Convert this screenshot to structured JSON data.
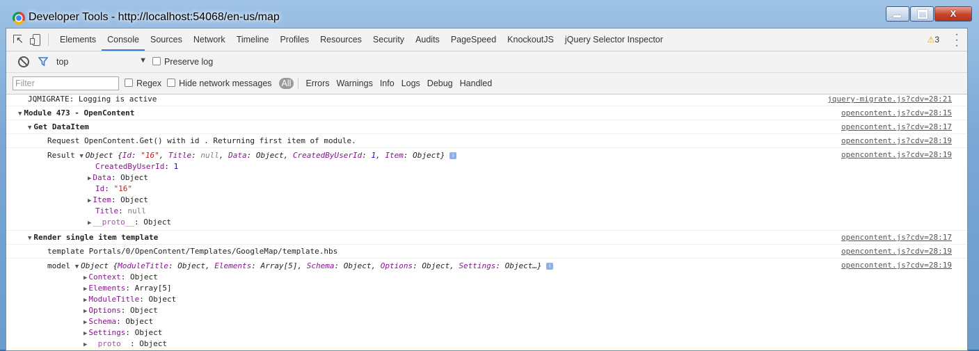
{
  "window": {
    "title": "Developer Tools - http://localhost:54068/en-us/map",
    "close_glyph": "X"
  },
  "tabs": [
    "Elements",
    "Console",
    "Sources",
    "Network",
    "Timeline",
    "Profiles",
    "Resources",
    "Security",
    "Audits",
    "PageSpeed",
    "KnockoutJS",
    "jQuery Selector Inspector"
  ],
  "active_tab": "Console",
  "warnings_count": "3",
  "context": {
    "value": "top",
    "preserve_log_label": "Preserve log"
  },
  "filter": {
    "placeholder": "Filter",
    "regex_label": "Regex",
    "hide_network_label": "Hide network messages",
    "levels": [
      "All",
      "Errors",
      "Warnings",
      "Info",
      "Logs",
      "Debug",
      "Handled"
    ]
  },
  "console": {
    "msg1": {
      "text": "JQMIGRATE: Logging is active",
      "src": "jquery-migrate.js?cdv=28:21"
    },
    "group1": {
      "text": "Module 473 - OpenContent",
      "src": "opencontent.js?cdv=28:15"
    },
    "group2": {
      "text": "Get DataItem",
      "src": "opencontent.js?cdv=28:17"
    },
    "msg2": {
      "text": "Request OpenContent.Get() with id . Returning first item of module.",
      "src": "opencontent.js?cdv=28:19"
    },
    "result": {
      "label": "Result",
      "src": "opencontent.js?cdv=28:19",
      "summary_prefix": "Object {",
      "s_id_key": "Id",
      "s_id_val": "\"16\"",
      "s_title_key": "Title",
      "s_title_val": "null",
      "s_data_key": "Data",
      "s_data_val": "Object",
      "s_cby_key": "CreatedByUserId",
      "s_cby_val": "1",
      "s_item_key": "Item",
      "s_item_val": "Object",
      "summary_suffix": "}",
      "props": [
        {
          "key": "CreatedByUserId",
          "val": "1"
        },
        {
          "key": "Data",
          "val": "Object"
        },
        {
          "key": "Id",
          "val": "\"16\""
        },
        {
          "key": "Item",
          "val": "Object"
        },
        {
          "key": "Title",
          "val": "null"
        },
        {
          "key": "__proto__",
          "val": "Object"
        }
      ]
    },
    "group3": {
      "text": "Render single item template",
      "src": "opencontent.js?cdv=28:17"
    },
    "msg3": {
      "text": "template Portals/0/OpenContent/Templates/GoogleMap/template.hbs",
      "src": "opencontent.js?cdv=28:19"
    },
    "model": {
      "label": "model",
      "src": "opencontent.js?cdv=28:19",
      "summary_prefix": "Object {",
      "s_mt_key": "ModuleTitle",
      "s_mt_val": "Object",
      "s_el_key": "Elements",
      "s_el_val": "Array[5]",
      "s_sc_key": "Schema",
      "s_sc_val": "Object",
      "s_op_key": "Options",
      "s_op_val": "Object",
      "s_se_key": "Settings",
      "s_se_val": "Object…}",
      "props": [
        {
          "key": "Context",
          "val": "Object"
        },
        {
          "key": "Elements",
          "val": "Array[5]"
        },
        {
          "key": "ModuleTitle",
          "val": "Object"
        },
        {
          "key": "Options",
          "val": "Object"
        },
        {
          "key": "Schema",
          "val": "Object"
        },
        {
          "key": "Settings",
          "val": "Object"
        },
        {
          "key": "__proto__",
          "val": "Object"
        }
      ]
    }
  }
}
